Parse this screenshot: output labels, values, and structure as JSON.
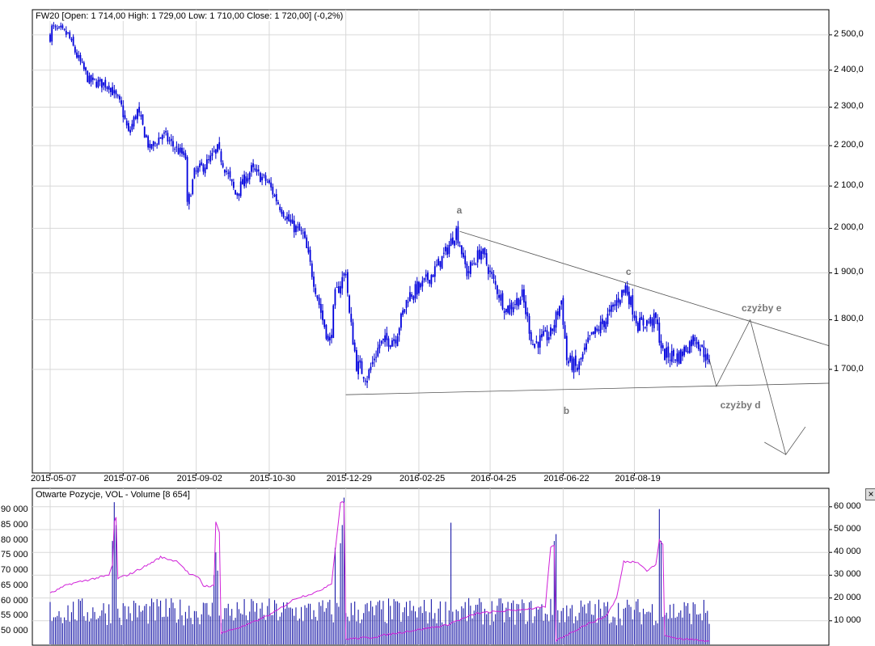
{
  "chart_data": [
    {
      "type": "candlestick",
      "title": "FW20 [Open: 1 714,00  High: 1 729,00  Low: 1 710,00  Close: 1 720,00] (-0,2%)",
      "y_scale": "log",
      "ylim": [
        1470,
        2560
      ],
      "y_ticks": [
        {
          "value": 2500,
          "label": "2 500,0"
        },
        {
          "value": 2400,
          "label": "2 400,0"
        },
        {
          "value": 2300,
          "label": "2 300,0"
        },
        {
          "value": 2200,
          "label": "2 200,0"
        },
        {
          "value": 2100,
          "label": "2 100,0"
        },
        {
          "value": 2000,
          "label": "2 000,0"
        },
        {
          "value": 1900,
          "label": "1 900,0"
        },
        {
          "value": 1800,
          "label": "1 800,0"
        },
        {
          "value": 1700,
          "label": "1 700,0"
        }
      ],
      "x_ticks": [
        {
          "index": 0,
          "label": "2015-05-07"
        },
        {
          "index": 41,
          "label": "2015-07-06"
        },
        {
          "index": 82,
          "label": "2015-09-02"
        },
        {
          "index": 123,
          "label": "2015-10-30"
        },
        {
          "index": 166,
          "label": "2015-12-29"
        },
        {
          "index": 207,
          "label": "2016-02-25"
        },
        {
          "index": 247,
          "label": "2016-04-25"
        },
        {
          "index": 288,
          "label": "2016-06-22"
        },
        {
          "index": 328,
          "label": "2016-08-19"
        }
      ],
      "close_keypoints": [
        [
          0,
          2495
        ],
        [
          1,
          2520
        ],
        [
          10,
          2500
        ],
        [
          15,
          2440
        ],
        [
          22,
          2370
        ],
        [
          33,
          2360
        ],
        [
          40,
          2300
        ],
        [
          44,
          2230
        ],
        [
          49,
          2290
        ],
        [
          56,
          2190
        ],
        [
          63,
          2230
        ],
        [
          69,
          2200
        ],
        [
          76,
          2170
        ],
        [
          77,
          2050
        ],
        [
          81,
          2130
        ],
        [
          89,
          2160
        ],
        [
          94,
          2190
        ],
        [
          104,
          2080
        ],
        [
          113,
          2140
        ],
        [
          122,
          2110
        ],
        [
          128,
          2060
        ],
        [
          135,
          2010
        ],
        [
          142,
          1985
        ],
        [
          147,
          1900
        ],
        [
          153,
          1800
        ],
        [
          157,
          1750
        ],
        [
          160,
          1850
        ],
        [
          166,
          1905
        ],
        [
          168,
          1810
        ],
        [
          172,
          1710
        ],
        [
          178,
          1685
        ],
        [
          185,
          1750
        ],
        [
          194,
          1765
        ],
        [
          201,
          1850
        ],
        [
          208,
          1870
        ],
        [
          215,
          1900
        ],
        [
          222,
          1945
        ],
        [
          228,
          1995
        ],
        [
          234,
          1900
        ],
        [
          242,
          1950
        ],
        [
          249,
          1880
        ],
        [
          256,
          1820
        ],
        [
          265,
          1850
        ],
        [
          271,
          1750
        ],
        [
          281,
          1770
        ],
        [
          287,
          1840
        ],
        [
          290,
          1720
        ],
        [
          296,
          1700
        ],
        [
          303,
          1760
        ],
        [
          312,
          1800
        ],
        [
          323,
          1870
        ],
        [
          330,
          1790
        ],
        [
          340,
          1800
        ],
        [
          344,
          1730
        ],
        [
          353,
          1725
        ],
        [
          362,
          1765
        ],
        [
          370,
          1715
        ]
      ],
      "last_candle": {
        "open": 1714,
        "high": 1729,
        "low": 1710,
        "close": 1720,
        "change_pct": -0.2
      },
      "annotations": {
        "lines": [
          {
            "name": "resistance-trendline",
            "points": [
              [
                230,
                1993
              ],
              [
                437,
                1747
              ]
            ]
          },
          {
            "name": "support-trendline",
            "points": [
              [
                166,
                1651
              ],
              [
                437,
                1673
              ]
            ]
          },
          {
            "name": "projected-wave-path",
            "points": [
              [
                370,
                1720
              ],
              [
                374,
                1667
              ],
              [
                393,
                1800
              ],
              [
                413,
                1541
              ],
              [
                424,
                1591
              ]
            ]
          },
          {
            "name": "projection-arrow-head",
            "points": [
              [
                401,
                1563
              ],
              [
                413,
                1541
              ]
            ]
          }
        ],
        "labels": [
          {
            "text": "a",
            "index": 230,
            "price": 2040
          },
          {
            "text": "b",
            "index": 290,
            "price": 1620
          },
          {
            "text": "c",
            "index": 325,
            "price": 1900
          },
          {
            "text": "czyżby d",
            "index": 378,
            "price": 1630
          },
          {
            "text": "czyżby e",
            "index": 390,
            "price": 1822
          }
        ]
      }
    },
    {
      "type": "bar+line",
      "title": "Otwarte Pozycje, VOL - Volume [8 654]",
      "left_axis": {
        "label": "Otwarte Pozycje",
        "ylim": [
          42000,
          95000
        ],
        "ticks": [
          "90 000",
          "85 000",
          "80 000",
          "75 000",
          "70 000",
          "65 000",
          "60 000",
          "55 000",
          "50 000"
        ],
        "tick_values": [
          90000,
          85000,
          80000,
          75000,
          70000,
          65000,
          60000,
          55000,
          50000
        ]
      },
      "right_axis": {
        "label": "Volume",
        "ylim": [
          0,
          67000
        ],
        "ticks": [
          "60 000",
          "50 000",
          "40 000",
          "30 000",
          "20 000",
          "10 000"
        ],
        "tick_values": [
          60000,
          50000,
          40000,
          30000,
          20000,
          10000
        ]
      },
      "last_volume": 8654,
      "open_interest_keypoints": [
        [
          0,
          62500
        ],
        [
          10,
          65500
        ],
        [
          25,
          67500
        ],
        [
          33,
          68500
        ],
        [
          35,
          72000
        ],
        [
          36,
          86000
        ],
        [
          37,
          87500
        ],
        [
          38,
          67500
        ],
        [
          45,
          69000
        ],
        [
          55,
          72000
        ],
        [
          62,
          74500
        ],
        [
          72,
          73000
        ],
        [
          78,
          69000
        ],
        [
          84,
          67500
        ],
        [
          86,
          65000
        ],
        [
          92,
          65000
        ],
        [
          93,
          86000
        ],
        [
          95,
          83000
        ],
        [
          96,
          49500
        ],
        [
          110,
          52000
        ],
        [
          125,
          56000
        ],
        [
          138,
          61000
        ],
        [
          150,
          63000
        ],
        [
          158,
          66000
        ],
        [
          163,
          92500
        ],
        [
          165,
          92500
        ],
        [
          166,
          47500
        ],
        [
          180,
          48000
        ],
        [
          200,
          50000
        ],
        [
          222,
          52000
        ],
        [
          226,
          53000
        ],
        [
          240,
          56000
        ],
        [
          260,
          57000
        ],
        [
          278,
          58000
        ],
        [
          281,
          78000
        ],
        [
          283,
          78000
        ],
        [
          284,
          47000
        ],
        [
          300,
          52000
        ],
        [
          312,
          55000
        ],
        [
          318,
          61000
        ],
        [
          322,
          73000
        ],
        [
          330,
          73000
        ],
        [
          335,
          70000
        ],
        [
          340,
          72000
        ],
        [
          342,
          80000
        ],
        [
          344,
          79000
        ],
        [
          345,
          48500
        ],
        [
          355,
          47500
        ],
        [
          370,
          47000
        ]
      ],
      "volume_spikes": [
        [
          35,
          45000
        ],
        [
          36,
          62000
        ],
        [
          37,
          52000
        ],
        [
          92,
          30000
        ],
        [
          93,
          40000
        ],
        [
          94,
          32000
        ],
        [
          160,
          42000
        ],
        [
          163,
          44000
        ],
        [
          164,
          52000
        ],
        [
          165,
          64000
        ],
        [
          225,
          53000
        ],
        [
          283,
          45000
        ],
        [
          284,
          48000
        ],
        [
          342,
          59000
        ],
        [
          343,
          45000
        ]
      ],
      "volume_baseline": [
        8000,
        20000
      ]
    }
  ],
  "close_button_label": "×"
}
